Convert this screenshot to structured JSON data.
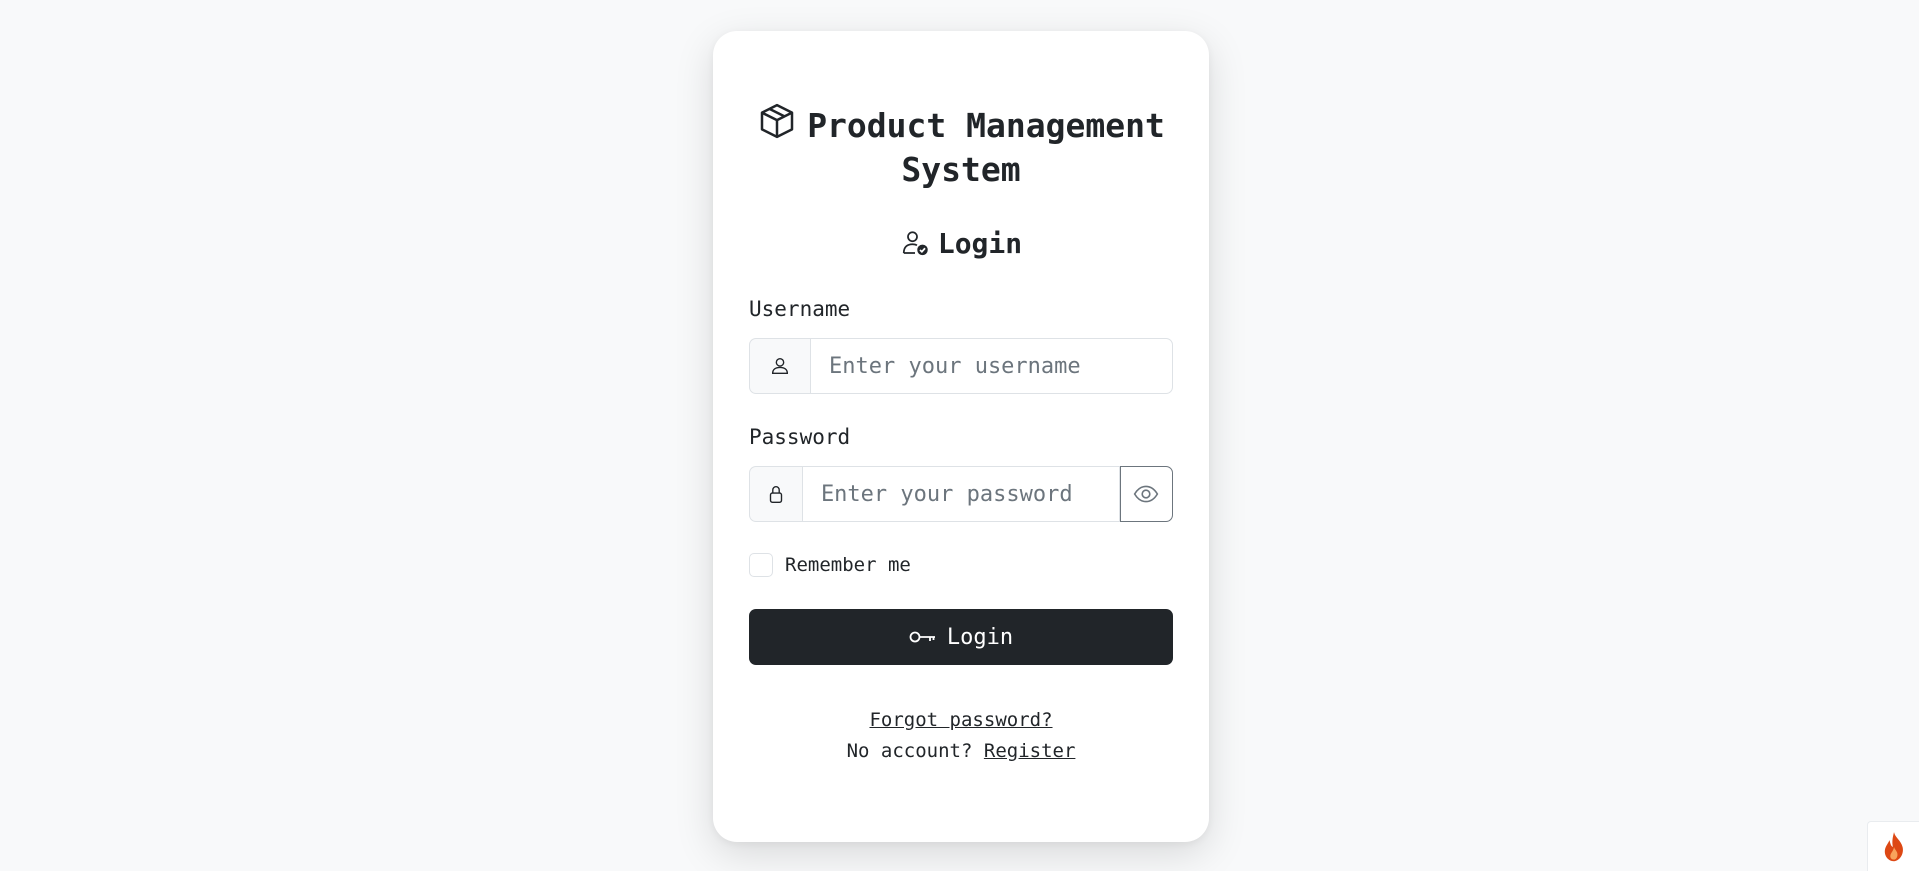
{
  "app": {
    "title": "Product Management System"
  },
  "form": {
    "heading": "Login",
    "username": {
      "label": "Username",
      "placeholder": "Enter your username",
      "value": ""
    },
    "password": {
      "label": "Password",
      "placeholder": "Enter your password",
      "value": ""
    },
    "remember_label": "Remember me",
    "remember_checked": false,
    "submit_label": "Login"
  },
  "links": {
    "forgot": "Forgot password?",
    "no_account": "No account?",
    "register": "Register"
  },
  "icons": {
    "title": "box-icon",
    "heading": "person-check-icon",
    "username": "person-icon",
    "password": "lock-icon",
    "toggle": "eye-icon",
    "submit": "key-icon",
    "corner": "flame-icon"
  },
  "colors": {
    "primary": "#212529",
    "background": "#f8f9fa",
    "border": "#dee2e6",
    "corner_accent": "#dd4814"
  }
}
